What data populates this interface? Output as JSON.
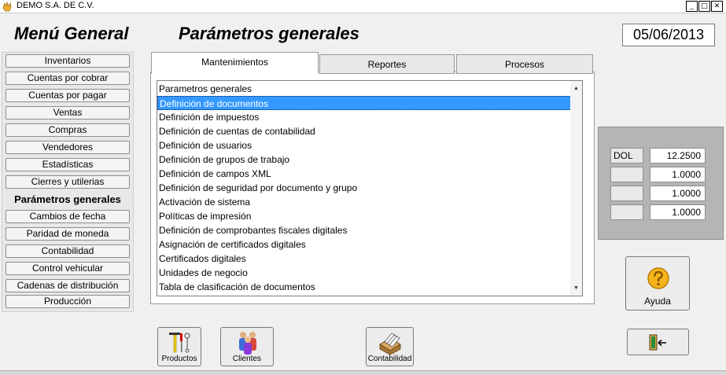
{
  "window": {
    "title": "DEMO  S.A. DE C.V.",
    "controls": {
      "minimize": "_",
      "maximize": "□",
      "close": "✕"
    }
  },
  "header": {
    "left_title": "Menú General",
    "main_title": "Parámetros generales",
    "date": "05/06/2013"
  },
  "sidebar": {
    "items": [
      "Inventarios",
      "Cuentas por cobrar",
      "Cuentas por pagar",
      "Ventas",
      "Compras",
      "Vendedores",
      "Estadísticas",
      "Cierres y utilerias",
      "Parámetros generales",
      "Cambios de fecha",
      "Paridad de moneda",
      "Contabilidad",
      "Control vehicular",
      "Cadenas de distribución",
      "Producción"
    ],
    "active_item": "Parámetros generales"
  },
  "tabs": {
    "items": [
      "Mantenimientos",
      "Reportes",
      "Procesos"
    ],
    "active": "Mantenimientos"
  },
  "list": {
    "items": [
      "Parametros generales",
      "Definición de documentos",
      "Definición de impuestos",
      "Definición de cuentas de contabilidad",
      "Definición de usuarios",
      "Definición de grupos de trabajo",
      "Definición de campos XML",
      "Definición de seguridad por documento y grupo",
      "Activación  de sistema",
      "Políticas de  impresión",
      "Definición de comprobantes fiscales digitales",
      "Asignación de certificados digitales",
      "Certificados digitales",
      "Unidades de negocio",
      "Tabla de clasificación de documentos"
    ],
    "selected": "Definición de documentos"
  },
  "rates": [
    {
      "code": "DOL",
      "value": "12.2500"
    },
    {
      "code": "",
      "value": "1.0000"
    },
    {
      "code": "",
      "value": "1.0000"
    },
    {
      "code": "",
      "value": "1.0000"
    }
  ],
  "buttons": {
    "help": "Ayuda",
    "productos": "Productos",
    "clientes": "Clientes",
    "contabilidad": "Contabilidad"
  },
  "colors": {
    "selection": "#3399ff",
    "background": "#f0f0f0",
    "rates_panel": "#b5b5b5"
  },
  "icons": {
    "app": "hand-icon",
    "help": "question-icon",
    "exit": "exit-door-icon",
    "productos": "tools-icon",
    "clientes": "people-icon",
    "contabilidad": "file-box-icon"
  }
}
